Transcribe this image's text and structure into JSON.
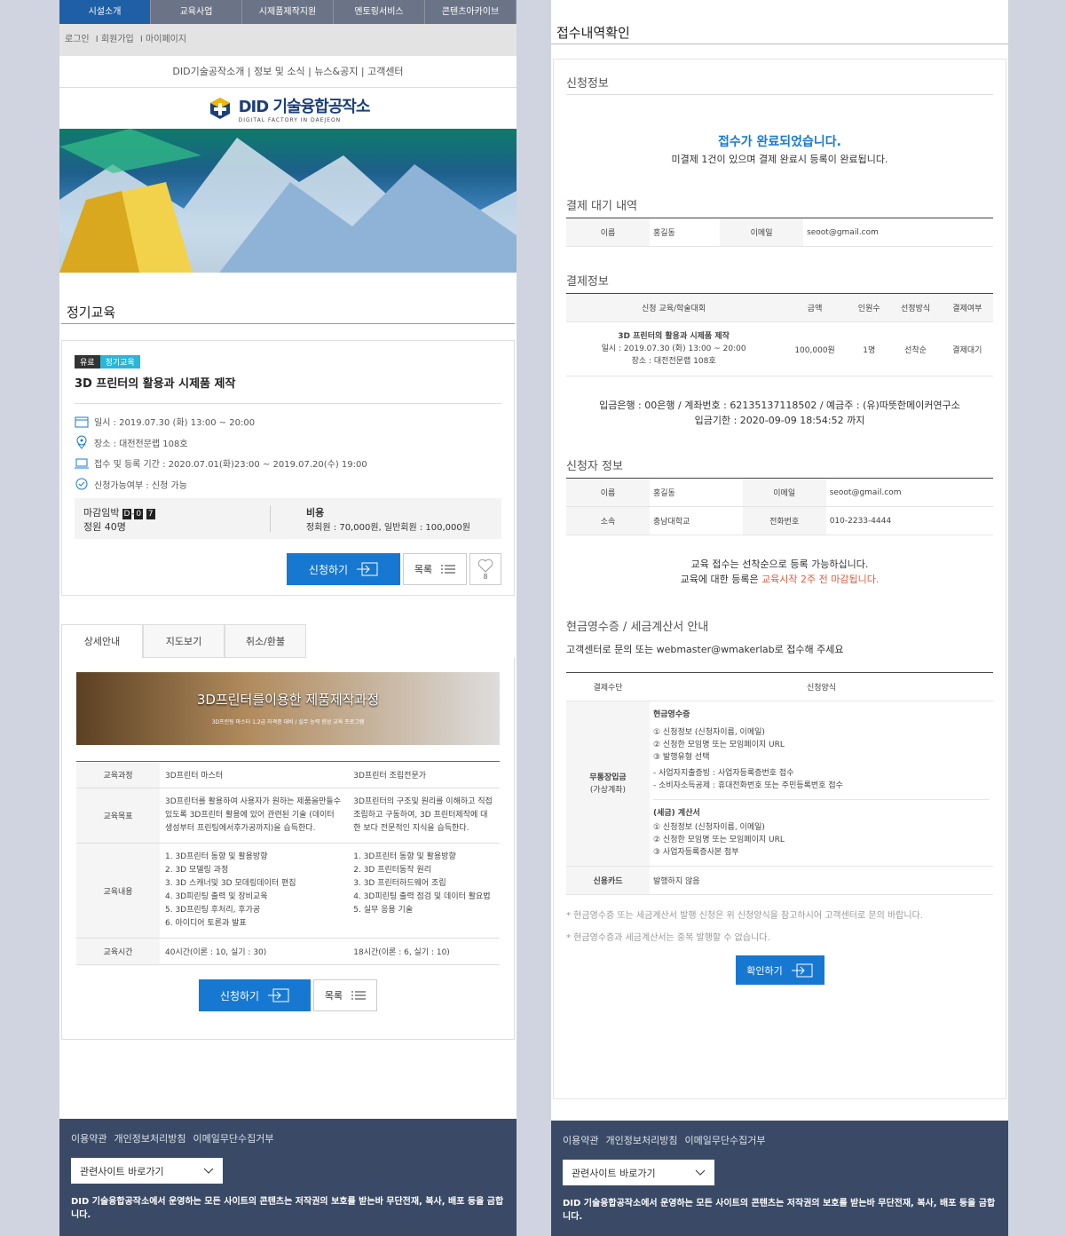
{
  "left": {
    "topnav": [
      "시설소개",
      "교육사업",
      "시제품제작지원",
      "멘토링서비스",
      "콘텐츠아카이브"
    ],
    "userbar": [
      "로그인",
      "I 회원가입",
      "I 마이페이지"
    ],
    "subnav": "DID기술공작소개 | 정보 및 소식 | 뉴스&공지 | 고객센터",
    "logo": {
      "name": "DID 기술융합공작소",
      "sub": "DIGITAL FACTORY IN DAEJEON"
    },
    "section_title": "정기교육",
    "course": {
      "badge_paid": "유료",
      "badge_type": "정기교육",
      "title": "3D 프린터의 활용과 시제품 제작",
      "date": "일시 : 2019.07.30 (화) 13:00 ~ 20:00",
      "place": "장소 : 대전전문랩 108호",
      "period": "접수 및 등록 기간 : 2020.07.01(화)23:00 ~ 2019.07.20(수) 19:00",
      "avail": "신청가능여부 : 신청 가능",
      "deadline_label": "마감임박",
      "d_chars": [
        "D",
        "0",
        "7"
      ],
      "capacity": "정원 40명",
      "cost_label": "비용",
      "cost": "정회원 : 70,000원, 일반회원 : 100,000원",
      "apply": "신청하기",
      "list": "목록",
      "likes": "8"
    },
    "tabs": [
      "상세안내",
      "지도보기",
      "취소/환불"
    ],
    "banner": {
      "title": "3D프린터를이용한 제품제작과정",
      "sub": "3D프린팅 마스터 1,2급 자격증 대비 / 실무 능력 향상 교육 프로그램"
    },
    "table": {
      "row1": {
        "h": "교육과정",
        "a": "3D프린터 마스터",
        "b": "3D프린터 조립전문가"
      },
      "row2": {
        "h": "교육목표",
        "a": "3D프린터를 활용하여 사용자가 원하는 제품을만들수 있도록 3D프린터 활용에 있어 관련된 기술 (데이터 생성부터 프린팅에서후가공까지)을 습득한다.",
        "b": "3D프린터의 구조및 원리를 이해하고 직접 조립하고 구동하여, 3D 프린터제작에 대한 보다 전문적인 지식을 습득한다."
      },
      "row3": {
        "h": "교육내용",
        "a": [
          "1. 3D프린터 동향 및 활용방향",
          "2. 3D 모델링 과정",
          "3. 3D 스캐너및 3D 모데링데이터 편집",
          "4. 3D피린팅 출력 및 장비교육",
          "5. 3D프린팅 후처리, 후가공",
          "6. 아이디어 토론과 발표"
        ],
        "b": [
          "1. 3D프린터 동향 및 활용방향",
          "2. 3D 프린터동작 원리",
          "3. 3D 프린터하드웨어 조립",
          "4. 3D피린팅 출력 점검 및 데이터 활요법",
          "5. 실무 응용 기술"
        ]
      },
      "row4": {
        "h": "교육시간",
        "a": "40시간(이론 : 10, 실기 : 30)",
        "b": "18시간(이론 : 6, 실기 : 10)"
      }
    },
    "bottom_apply": "신청하기",
    "bottom_list": "목록"
  },
  "right": {
    "title": "접수내역확인",
    "s1": "신청정보",
    "done1": "접수가 완료되었습니다.",
    "done2": "미결제 1건이 있으며 결제 완료시 등록이 완료됩니다.",
    "s2": "결제 대기 내역",
    "pending": {
      "name_h": "이름",
      "name": "홍길동",
      "email_h": "이메일",
      "email": "seoot@gmail.com"
    },
    "s3": "결제정보",
    "pay_head": [
      "신청 교육/학술대회",
      "금액",
      "인원수",
      "선정방식",
      "결제여부"
    ],
    "pay_row": {
      "title": "3D 프린터의 활용과 시제품 제작",
      "date": "일시 : 2019.07.30 (화) 13:00 ~ 20:00",
      "place": "장소 : 대전전문랩 108호",
      "amount": "100,000원",
      "people": "1명",
      "method": "선착순",
      "status": "결제대기"
    },
    "bank1": "입금은행 : 00은행 / 계좌번호 : 62135137118502 / 예금주 : (유)따뜻한메이커연구소",
    "bank2": "입금기한 : 2020-09-09 18:54:52 까지",
    "s4": "신청자 정보",
    "applicant": {
      "name_h": "이름",
      "name": "홍길동",
      "email_h": "이메일",
      "email": "seoot@gmail.com",
      "org_h": "소속",
      "org": "충남대학교",
      "phone_h": "전화번호",
      "phone": "010-2233-4444"
    },
    "note1": "교육 접수는 선착순으로 등록 가능하십니다.",
    "note2a": "교육에 대한 등록은 ",
    "note2b": "교육시작 2주 전 마감됩니다.",
    "s5": "현금영수증 / 세금계산서 안내",
    "contact": "고객센터로 문의 또는 webmaster@wmakerlab로 접수해 주세요",
    "rc_head": [
      "결제수단",
      "신청양식"
    ],
    "rc": {
      "method1": "무통장입금",
      "method1b": "(가상계좌)",
      "cash_title": "현금영수증",
      "cash": [
        "① 신청정보 (신청자이름, 이메일)",
        "② 신청한 모임명 또는 모임페이지 URL",
        "③ 발행유형 선택"
      ],
      "cash2": [
        "- 사업자지출증빙 : 사업자등록증번호 접수",
        "- 소비자소득공제 : 휴대전화번호 또는 주민등록번호 접수"
      ],
      "tax_title": "(세금) 계산서",
      "tax": [
        "① 신청정보 (신청자이름, 이메일)",
        "② 신청한 모임명 또는 모임페이지 URL",
        "③ 사업자등록증사본 첨부"
      ],
      "method2": "신용카드",
      "method2v": "발행하지 않음"
    },
    "foot1": "* 현금영수증 또는 세금계산서 발행 신청은 위 신청양식을 참고하시어 고객센터로 문의 바랍니다.",
    "foot2": "* 현금영수증과 세금계산서는 중복 발행할 수 없습니다.",
    "confirm": "확인하기"
  },
  "footer": {
    "links": [
      "이용약관",
      "개인정보처리방침",
      "이메일무단수집거부"
    ],
    "select": "관련사이트 바로가기",
    "copy": "DID 기술융합공작소에서 운영하는 모든 사이트의 콘텐츠는 저작권의 보호를 받는바 무단전재, 복사, 배포 등을 금합니다."
  }
}
